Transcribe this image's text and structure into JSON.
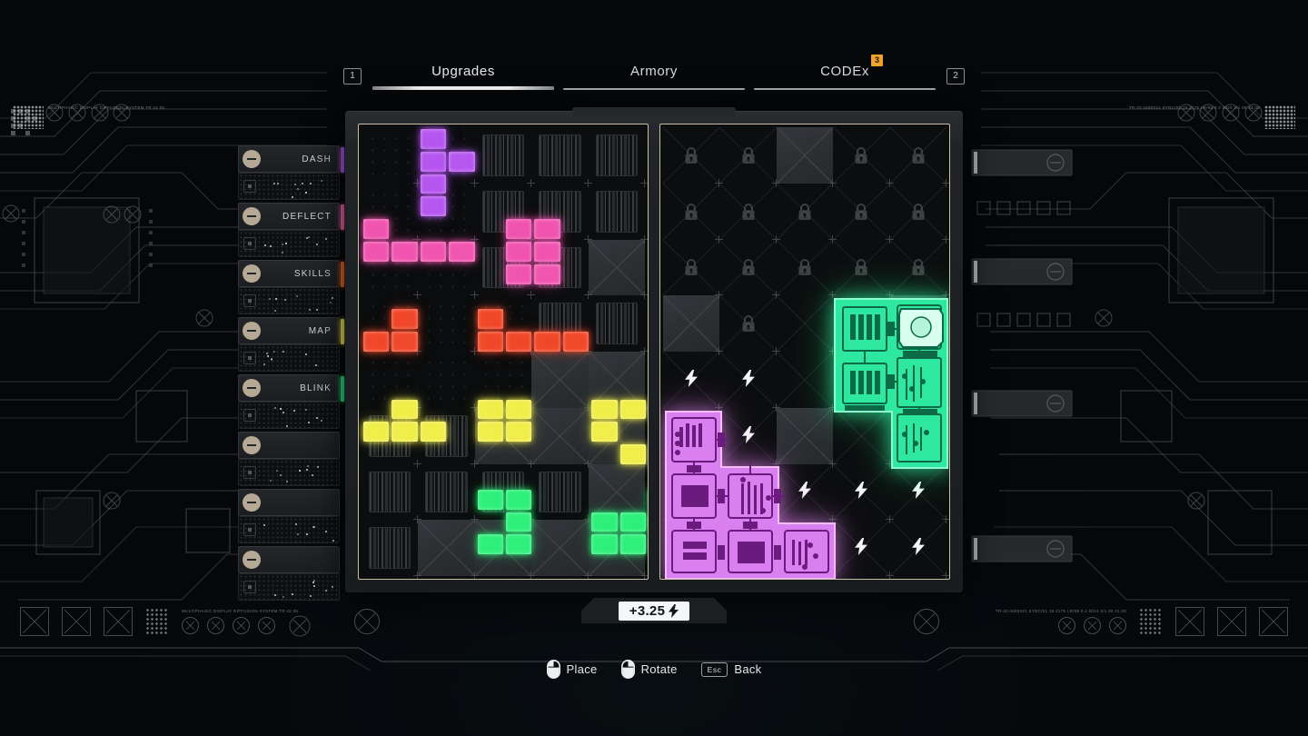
{
  "app": {
    "title": "Upgrades Screen",
    "accent_cream": "#c9bfa6",
    "badge_color": "#f0a32a"
  },
  "tabbar": {
    "left_key": "1",
    "right_key": "2",
    "tabs": [
      {
        "label": "Upgrades",
        "active": true,
        "badge": null
      },
      {
        "label": "Armory",
        "active": false,
        "badge": null
      },
      {
        "label": "CODEx",
        "active": false,
        "badge": "3"
      }
    ]
  },
  "sidebar": {
    "items": [
      {
        "label": "DASH",
        "accent": "#b05ae8",
        "locked": false
      },
      {
        "label": "DEFLECT",
        "accent": "#f06aa8",
        "locked": false
      },
      {
        "label": "SKILLS",
        "accent": "#f2682a",
        "locked": false
      },
      {
        "label": "MAP",
        "accent": "#f2e85a",
        "locked": false
      },
      {
        "label": "BLINK",
        "accent": "#2ee88a",
        "locked": false
      },
      {
        "label": "",
        "accent": "",
        "locked": true
      },
      {
        "label": "",
        "accent": "",
        "locked": true
      },
      {
        "label": "",
        "accent": "",
        "locked": true
      }
    ]
  },
  "inventory_panel": {
    "name": "inventory-grid",
    "columns": 5,
    "rows": 8,
    "cell_types": [
      [
        "dotted",
        "dotted",
        "barcode",
        "barcode",
        "barcode"
      ],
      [
        "dotted",
        "dotted",
        "barcode",
        "barcode",
        "barcode"
      ],
      [
        "dotted",
        "dotted",
        "barcode",
        "barcode",
        "blocked"
      ],
      [
        "dotted",
        "dotted",
        "dotted",
        "barcode",
        "barcode"
      ],
      [
        "dotted",
        "dotted",
        "dotted",
        "blocked",
        "blocked"
      ],
      [
        "barcode",
        "barcode",
        "blocked",
        "blocked",
        "blocked"
      ],
      [
        "barcode",
        "barcode",
        "barcode",
        "barcode",
        "blocked"
      ],
      [
        "barcode",
        "blocked",
        "blocked",
        "blocked",
        "blocked"
      ]
    ],
    "pieces": [
      {
        "name": "piece-violet",
        "color": "#b657f0",
        "cells": [
          [
            2,
            0
          ],
          [
            2,
            1
          ],
          [
            3,
            1
          ],
          [
            2,
            2
          ],
          [
            2,
            3
          ]
        ]
      },
      {
        "name": "piece-pink",
        "color": "#f055b0",
        "cells": [
          [
            0,
            4
          ],
          [
            0,
            5
          ],
          [
            1,
            5
          ],
          [
            2,
            5
          ],
          [
            3,
            5
          ]
        ]
      },
      {
        "name": "piece-pink-2",
        "color": "#f055b0",
        "cells": [
          [
            5,
            4
          ],
          [
            6,
            4
          ],
          [
            5,
            5
          ],
          [
            6,
            5
          ],
          [
            5,
            6
          ],
          [
            6,
            6
          ]
        ]
      },
      {
        "name": "piece-red",
        "color": "#f0482a",
        "cells": [
          [
            1,
            8
          ],
          [
            0,
            9
          ],
          [
            1,
            9
          ]
        ]
      },
      {
        "name": "piece-red-2",
        "color": "#f0482a",
        "cells": [
          [
            4,
            8
          ],
          [
            4,
            9
          ],
          [
            5,
            9
          ],
          [
            6,
            9
          ],
          [
            7,
            9
          ]
        ]
      },
      {
        "name": "piece-yellow",
        "color": "#f0ee4a",
        "cells": [
          [
            1,
            12
          ],
          [
            0,
            13
          ],
          [
            1,
            13
          ],
          [
            2,
            13
          ]
        ]
      },
      {
        "name": "piece-yellow-2",
        "color": "#f0ee4a",
        "cells": [
          [
            4,
            12
          ],
          [
            5,
            12
          ],
          [
            4,
            13
          ],
          [
            5,
            13
          ]
        ]
      },
      {
        "name": "piece-yellow-3",
        "color": "#f0ee4a",
        "cells": [
          [
            8,
            12
          ],
          [
            9,
            12
          ],
          [
            8,
            13
          ],
          [
            9,
            14
          ]
        ]
      },
      {
        "name": "piece-green",
        "color": "#2ef07a",
        "cells": [
          [
            4,
            16
          ],
          [
            5,
            16
          ],
          [
            5,
            17
          ],
          [
            4,
            18
          ],
          [
            5,
            18
          ]
        ]
      },
      {
        "name": "piece-green-2",
        "color": "#2ef07a",
        "cells": [
          [
            10,
            16
          ],
          [
            11,
            16
          ],
          [
            8,
            17
          ],
          [
            9,
            17
          ],
          [
            10,
            17
          ],
          [
            8,
            18
          ],
          [
            9,
            18
          ]
        ]
      }
    ]
  },
  "circuit_panel": {
    "name": "circuit-board-grid",
    "columns": 5,
    "rows": 8,
    "cell_states": [
      [
        "locked",
        "locked",
        "blocked",
        "locked",
        "locked"
      ],
      [
        "locked",
        "locked",
        "locked",
        "locked",
        "locked"
      ],
      [
        "locked",
        "locked",
        "locked",
        "locked",
        "locked"
      ],
      [
        "blocked",
        "locked",
        "filled",
        "filled",
        "blocked"
      ],
      [
        "powered",
        "powered",
        "filled",
        "filled",
        "powered"
      ],
      [
        "filled",
        "powered",
        "blocked",
        "filled",
        "powered"
      ],
      [
        "filled",
        "filled",
        "powered",
        "powered",
        "powered"
      ],
      [
        "filled",
        "filled",
        "filled",
        "powered",
        "powered"
      ]
    ],
    "glyphs": {
      "locked": "lock-icon",
      "powered": "bolt-icon",
      "blocked": "x-block-icon"
    },
    "modules": [
      {
        "name": "module-green",
        "color": "#25e890",
        "glow": "#2effa0"
      },
      {
        "name": "module-magenta",
        "color": "#d96fe8",
        "glow": "#ea8cf5"
      }
    ]
  },
  "energy": {
    "name": "energy-readout",
    "value": "+3.25",
    "icon": "bolt-icon"
  },
  "hints": [
    {
      "label": "Place",
      "icon": "mouse-left-icon"
    },
    {
      "label": "Rotate",
      "icon": "mouse-right-icon"
    },
    {
      "label": "Back",
      "icon": "esc-key",
      "key": "Esc"
    }
  ],
  "decor": {
    "left_microtext": "MULTIPHASIC DISPLAY\nDIFFUSION SYSTEM  TR 42 05",
    "right_microtext": "TR-20.0480321 SYNC/01 18.2175\nLR/88 0.2 0024 2/1  00 41 00"
  }
}
